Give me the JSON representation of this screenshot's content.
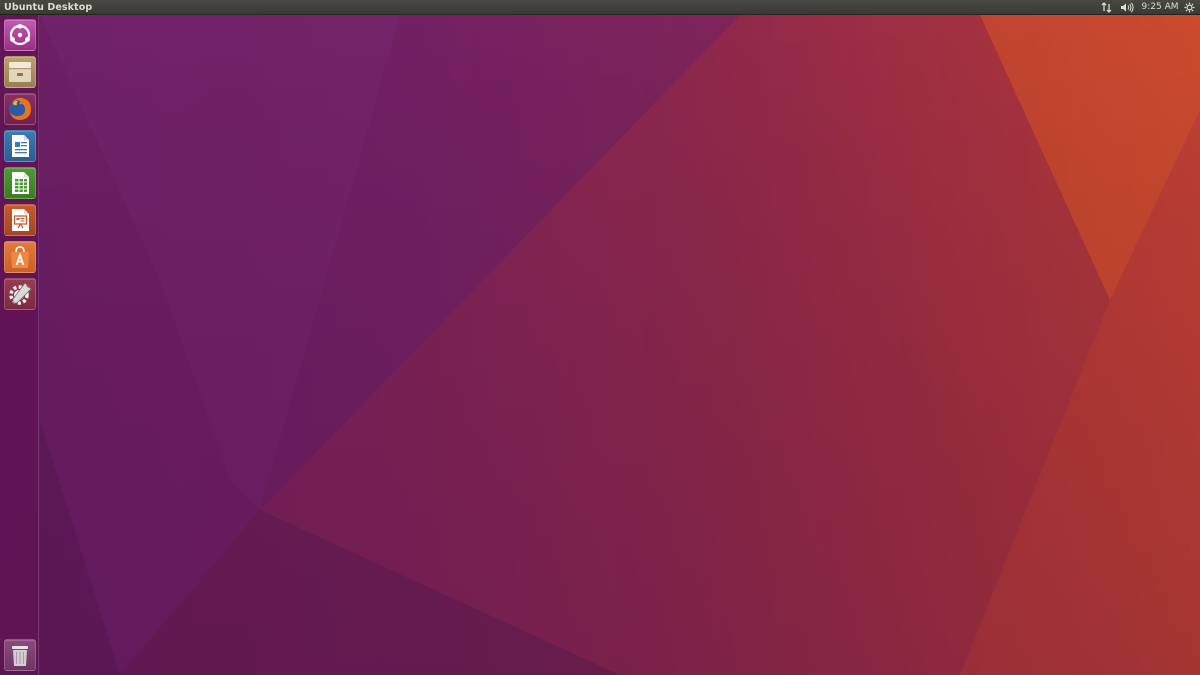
{
  "top_panel": {
    "title": "Ubuntu Desktop",
    "clock": "9:25 AM",
    "indicators": [
      {
        "name": "network-icon"
      },
      {
        "name": "sound-icon"
      },
      {
        "name": "session-gear-icon"
      }
    ]
  },
  "launcher": {
    "items": [
      {
        "id": "dash",
        "icon": "ubuntu-logo-icon"
      },
      {
        "id": "files",
        "icon": "file-cabinet-icon"
      },
      {
        "id": "firefox",
        "icon": "firefox-icon"
      },
      {
        "id": "writer",
        "icon": "libreoffice-writer-icon"
      },
      {
        "id": "calc",
        "icon": "libreoffice-calc-icon"
      },
      {
        "id": "impress",
        "icon": "libreoffice-impress-icon"
      },
      {
        "id": "software",
        "icon": "ubuntu-software-icon"
      },
      {
        "id": "settings",
        "icon": "system-settings-icon"
      },
      {
        "id": "trash",
        "icon": "trash-icon"
      }
    ]
  },
  "colors": {
    "wallpaper_purple": "#6a1d66",
    "wallpaper_magenta": "#8c2a55",
    "wallpaper_orange": "#c2412f",
    "panel_bg": "#3c3b37",
    "panel_text": "#dfdbd2"
  }
}
